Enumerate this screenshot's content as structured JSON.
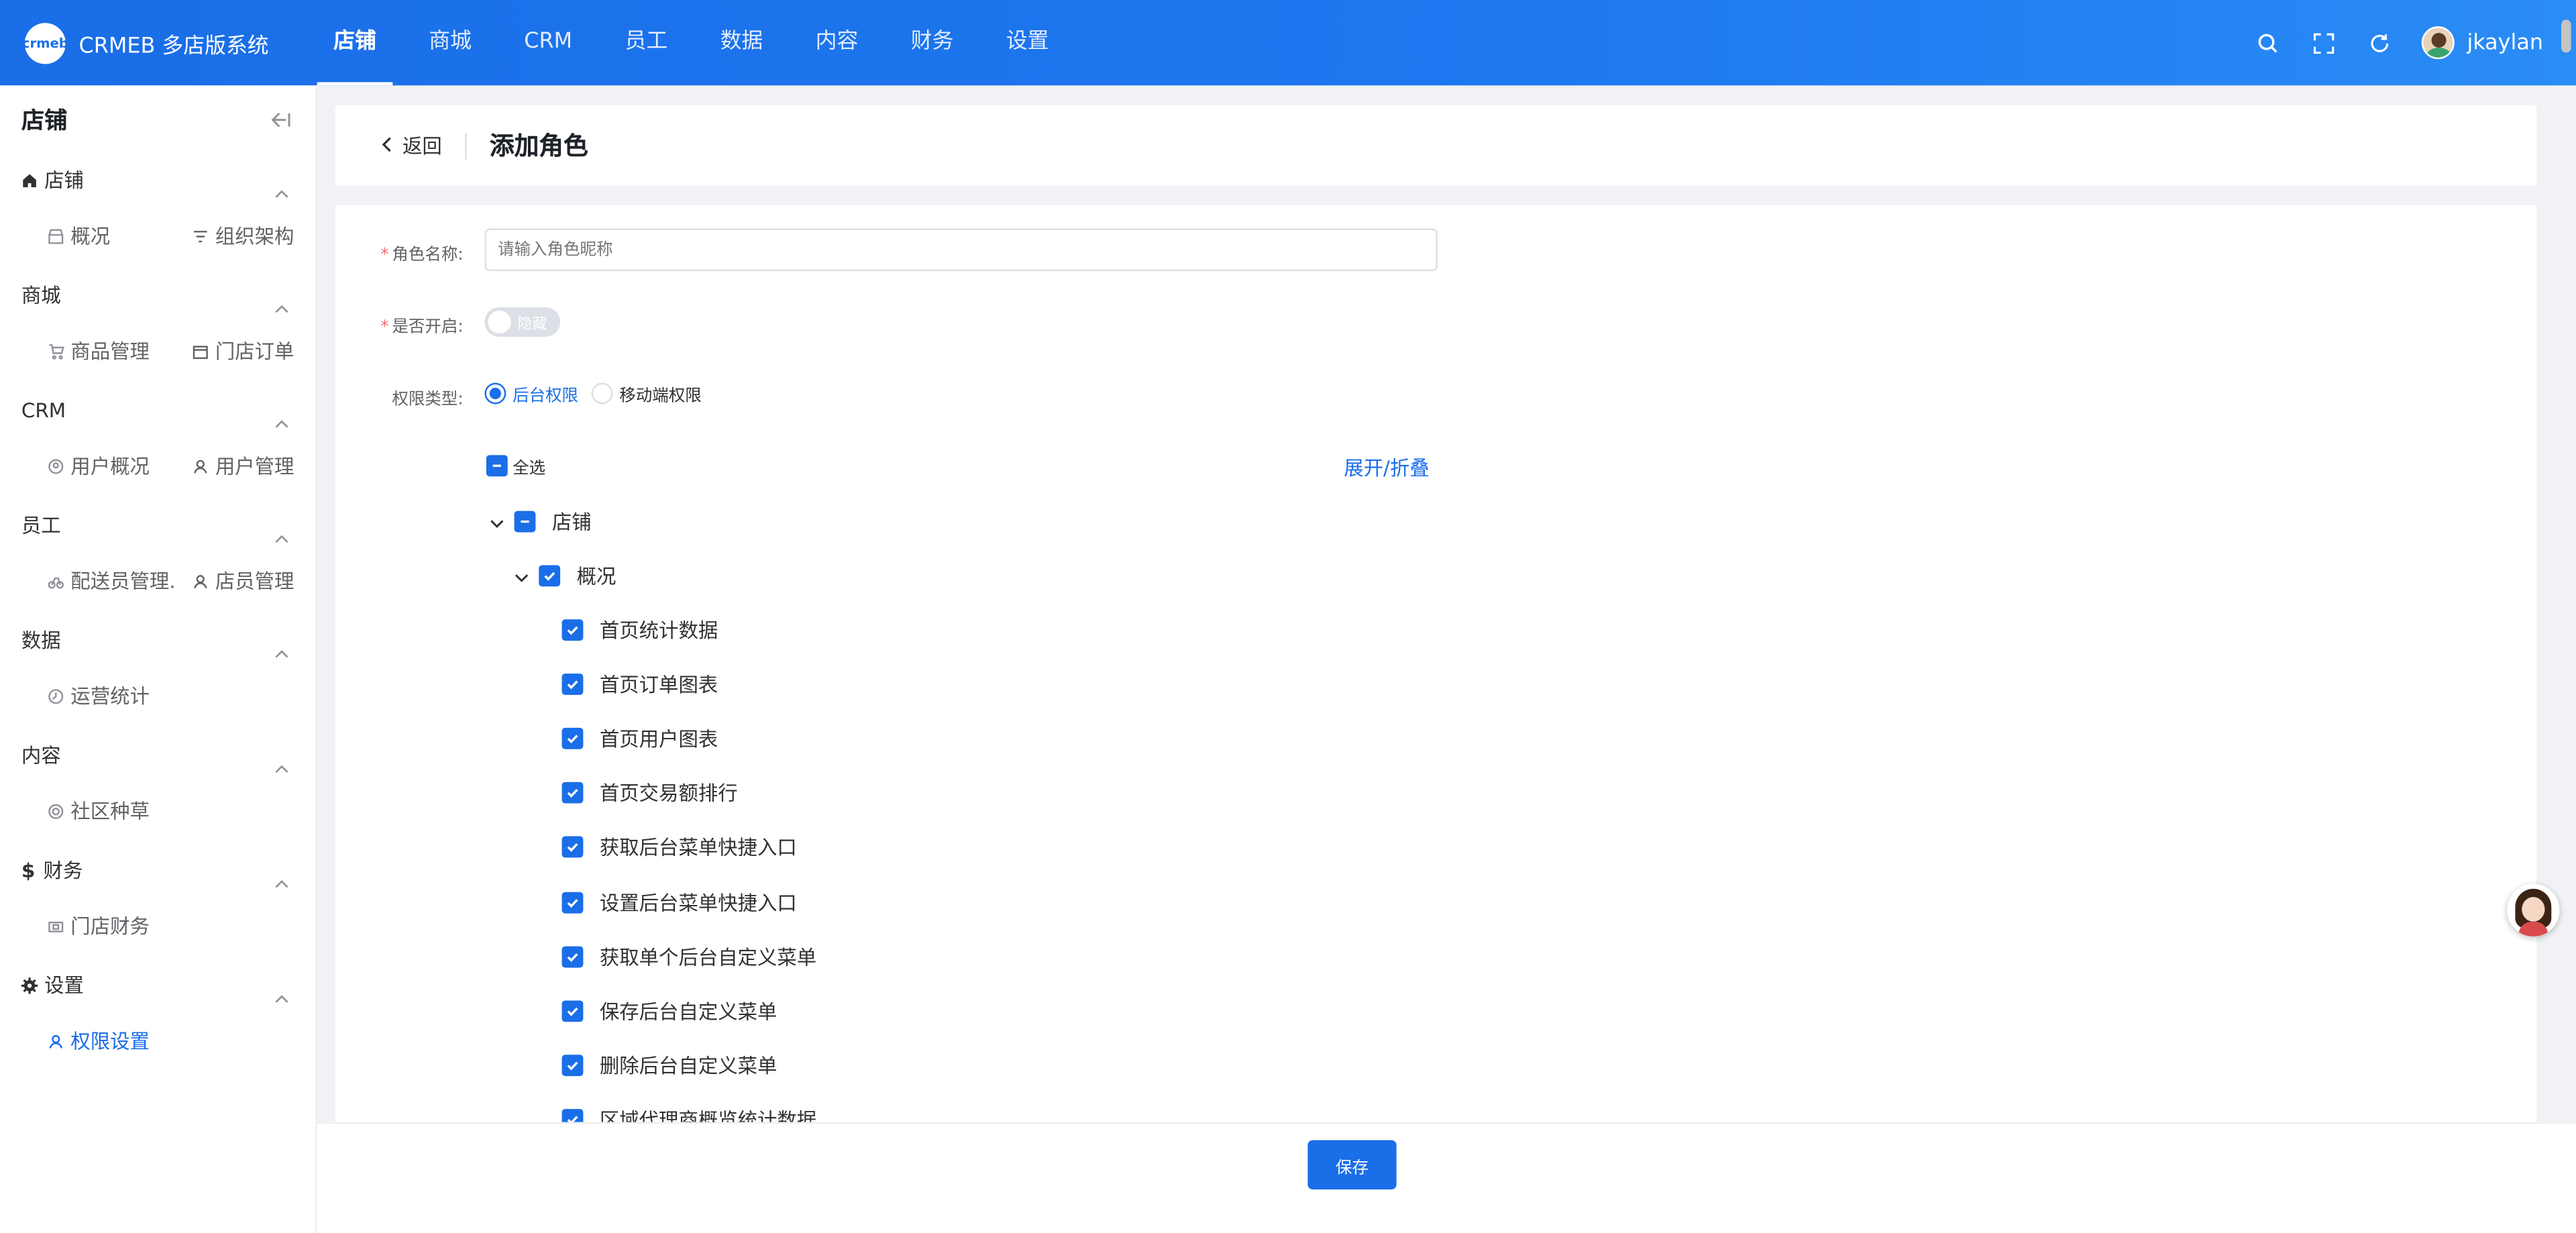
{
  "app": {
    "logo_text": "crmeb",
    "title": "CRMEB 多店版系统"
  },
  "topnav": [
    {
      "label": "店铺",
      "active": true
    },
    {
      "label": "商城"
    },
    {
      "label": "CRM"
    },
    {
      "label": "员工"
    },
    {
      "label": "数据"
    },
    {
      "label": "内容"
    },
    {
      "label": "财务"
    },
    {
      "label": "设置"
    }
  ],
  "header_right": {
    "icons": [
      "search-icon",
      "fullscreen-icon",
      "refresh-icon"
    ],
    "username": "jkaylan"
  },
  "sidebar": {
    "title": "店铺",
    "groups": [
      {
        "label": "店铺",
        "icon": "home-icon",
        "items": [
          {
            "label": "概况",
            "icon": "store-icon"
          },
          {
            "label": "组织架构",
            "icon": "filter-icon"
          }
        ]
      },
      {
        "label": "商城",
        "items": [
          {
            "label": "商品管理",
            "icon": "cart-icon"
          },
          {
            "label": "门店订单",
            "icon": "order-icon"
          }
        ]
      },
      {
        "label": "CRM",
        "items": [
          {
            "label": "用户概况",
            "icon": "user-circle-icon"
          },
          {
            "label": "用户管理",
            "icon": "user-icon"
          }
        ]
      },
      {
        "label": "员工",
        "items": [
          {
            "label": "配送员管理.",
            "icon": "bike-icon"
          },
          {
            "label": "店员管理",
            "icon": "user-icon"
          }
        ]
      },
      {
        "label": "数据",
        "items": [
          {
            "label": "运营统计",
            "icon": "clock-icon"
          }
        ]
      },
      {
        "label": "内容",
        "items": [
          {
            "label": "社区种草",
            "icon": "target-icon"
          }
        ]
      },
      {
        "label": "财务",
        "icon": "dollar-icon",
        "items": [
          {
            "label": "门店财务",
            "icon": "wallet-icon"
          }
        ]
      },
      {
        "label": "设置",
        "icon": "gear-icon",
        "items": [
          {
            "label": "权限设置",
            "icon": "user-icon",
            "active": true
          }
        ]
      }
    ]
  },
  "page": {
    "back_label": "返回",
    "title": "添加角色"
  },
  "form": {
    "role_name_label": "角色名称:",
    "role_name_placeholder": "请输入角色昵称",
    "enabled_label": "是否开启:",
    "enabled_switch_text": "隐藏",
    "perm_type_label": "权限类型:",
    "perm_types": [
      {
        "label": "后台权限",
        "checked": true
      },
      {
        "label": "移动端权限",
        "checked": false
      }
    ],
    "select_all_label": "全选",
    "expand_collapse_label": "展开/折叠"
  },
  "tree": {
    "root": {
      "label": "店铺",
      "state": "indeterminate"
    },
    "child": {
      "label": "概况",
      "state": "checked"
    },
    "leaves": [
      "首页统计数据",
      "首页订单图表",
      "首页用户图表",
      "首页交易额排行",
      "获取后台菜单快捷入口",
      "设置后台菜单快捷入口",
      "获取单个后台自定义菜单",
      "保存后台自定义菜单",
      "删除后台自定义菜单",
      "区域代理商概览统计数据"
    ]
  },
  "footer": {
    "save_label": "保存"
  },
  "colors": {
    "primary": "#1a6ee8",
    "required": "#f56c6c"
  }
}
